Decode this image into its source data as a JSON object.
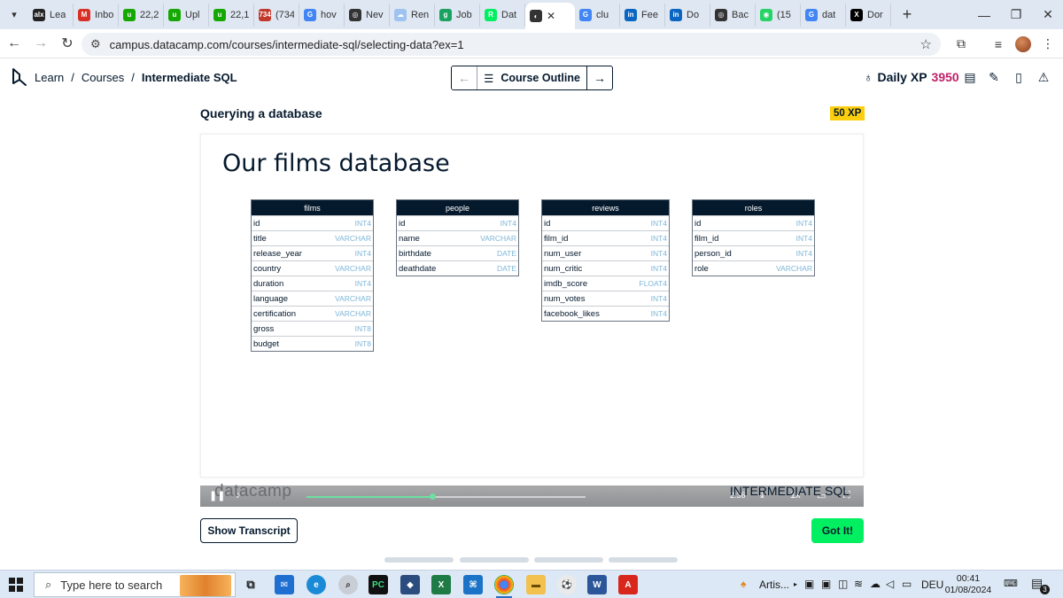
{
  "browser": {
    "tabs": [
      {
        "label": "Lea",
        "icon": "alx-icon",
        "color": "#222222",
        "glyph": "alx"
      },
      {
        "label": "Inbo",
        "icon": "gmail-icon",
        "color": "#d93025",
        "glyph": "M"
      },
      {
        "label": "22,2",
        "icon": "upwork-icon",
        "color": "#14a800",
        "glyph": "u"
      },
      {
        "label": "Upl",
        "icon": "upwork-icon",
        "color": "#14a800",
        "glyph": "u"
      },
      {
        "label": "22,1",
        "icon": "upwork-icon",
        "color": "#14a800",
        "glyph": "u"
      },
      {
        "label": "(734",
        "icon": "mail-icon",
        "color": "#c0392b",
        "glyph": "734"
      },
      {
        "label": "hov",
        "icon": "google-icon",
        "color": "#4285f4",
        "glyph": "G"
      },
      {
        "label": "Nev",
        "icon": "openai-icon",
        "color": "#333333",
        "glyph": "◎"
      },
      {
        "label": "Ren",
        "icon": "cloud-icon",
        "color": "#9ec3f0",
        "glyph": "☁"
      },
      {
        "label": "Job",
        "icon": "job-icon",
        "color": "#1aa260",
        "glyph": "g"
      },
      {
        "label": "Dat",
        "icon": "datacamp-icon",
        "color": "#03ef62",
        "glyph": "R"
      },
      {
        "label": "",
        "icon": "audio-icon",
        "color": "#333333",
        "glyph": "◐",
        "active": true
      },
      {
        "label": "clu",
        "icon": "google-icon",
        "color": "#4285f4",
        "glyph": "G"
      },
      {
        "label": "Fee",
        "icon": "linkedin-icon",
        "color": "#0a66c2",
        "glyph": "in"
      },
      {
        "label": "Do",
        "icon": "linkedin-icon",
        "color": "#0a66c2",
        "glyph": "in"
      },
      {
        "label": "Bac",
        "icon": "openai-icon",
        "color": "#333333",
        "glyph": "◎"
      },
      {
        "label": "(15",
        "icon": "whatsapp-icon",
        "color": "#25d366",
        "glyph": "◉"
      },
      {
        "label": "dat",
        "icon": "google-icon",
        "color": "#4285f4",
        "glyph": "G"
      },
      {
        "label": "Dor",
        "icon": "x-icon",
        "color": "#000000",
        "glyph": "X"
      }
    ],
    "url": "campus.datacamp.com/courses/intermediate-sql/selecting-data?ex=1"
  },
  "header": {
    "breadcrumb": [
      "Learn",
      "Courses",
      "Intermediate SQL"
    ],
    "outline_label": "Course Outline",
    "daily_xp_label": "Daily XP",
    "daily_xp_value": "3950"
  },
  "lesson": {
    "title": "Querying a database",
    "xp_badge": "50 XP",
    "slide_title": "Our films database",
    "tables": [
      {
        "name": "films",
        "columns": [
          {
            "name": "id",
            "type": "INT4"
          },
          {
            "name": "title",
            "type": "VARCHAR"
          },
          {
            "name": "release_year",
            "type": "INT4"
          },
          {
            "name": "country",
            "type": "VARCHAR"
          },
          {
            "name": "duration",
            "type": "INT4"
          },
          {
            "name": "language",
            "type": "VARCHAR"
          },
          {
            "name": "certification",
            "type": "VARCHAR"
          },
          {
            "name": "gross",
            "type": "INT8"
          },
          {
            "name": "budget",
            "type": "INT8"
          }
        ]
      },
      {
        "name": "people",
        "columns": [
          {
            "name": "id",
            "type": "INT4"
          },
          {
            "name": "name",
            "type": "VARCHAR"
          },
          {
            "name": "birthdate",
            "type": "DATE"
          },
          {
            "name": "deathdate",
            "type": "DATE"
          }
        ]
      },
      {
        "name": "reviews",
        "columns": [
          {
            "name": "id",
            "type": "INT4"
          },
          {
            "name": "film_id",
            "type": "INT4"
          },
          {
            "name": "num_user",
            "type": "INT4"
          },
          {
            "name": "num_critic",
            "type": "INT4"
          },
          {
            "name": "imdb_score",
            "type": "FLOAT4"
          },
          {
            "name": "num_votes",
            "type": "INT4"
          },
          {
            "name": "facebook_likes",
            "type": "INT4"
          }
        ]
      },
      {
        "name": "roles",
        "columns": [
          {
            "name": "id",
            "type": "INT4"
          },
          {
            "name": "film_id",
            "type": "INT4"
          },
          {
            "name": "person_id",
            "type": "INT4"
          },
          {
            "name": "role",
            "type": "VARCHAR"
          }
        ]
      }
    ],
    "video": {
      "watermark": "datacamp",
      "brand": "INTERMEDIATE SQL",
      "progress": 0.45,
      "time": "2:36",
      "speed": "1x"
    },
    "transcript_button": "Show Transcript",
    "gotit_button": "Got It!"
  },
  "taskbar": {
    "search_placeholder": "Type here to search",
    "weather_label": "Artis...",
    "language": "DEU",
    "time": "00:41",
    "date": "01/08/2024",
    "notifications": "3"
  }
}
